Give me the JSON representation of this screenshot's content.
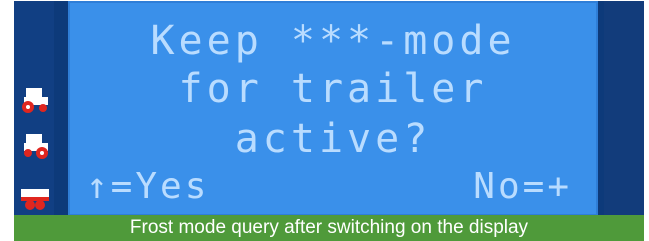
{
  "display": {
    "line1": "Keep ***-mode",
    "line2": "for trailer",
    "line3": "active?",
    "left_prompt": "↑=Yes",
    "right_prompt": "No=+"
  },
  "sidebar": {
    "icons": [
      {
        "name": "tractor-icon"
      },
      {
        "name": "tractor-icon"
      },
      {
        "name": "trailer-icon"
      }
    ]
  },
  "caption": {
    "text": "Frost mode query after switching on the display"
  },
  "colors": {
    "screen": "#3a90ea",
    "text": "#b9dcff",
    "frame": "#0d3a7a",
    "caption_bg": "#4f9a3a",
    "icon_red": "#e0261f",
    "icon_white": "#ffffff"
  }
}
